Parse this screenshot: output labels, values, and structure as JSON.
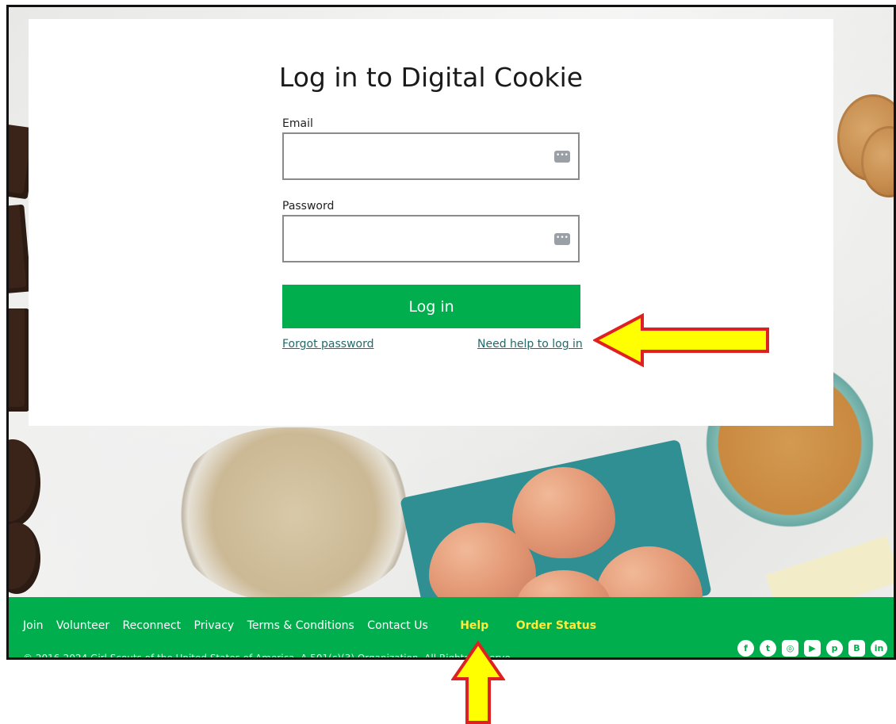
{
  "login": {
    "title": "Log in to Digital Cookie",
    "email_label": "Email",
    "email_value": "",
    "password_label": "Password",
    "password_value": "",
    "login_button": "Log in",
    "forgot_password": "Forgot password",
    "need_help": "Need help to log in"
  },
  "footer": {
    "nav": [
      {
        "label": "Join"
      },
      {
        "label": "Volunteer"
      },
      {
        "label": "Reconnect"
      },
      {
        "label": "Privacy"
      },
      {
        "label": "Terms & Conditions"
      },
      {
        "label": "Contact Us"
      }
    ],
    "help": "Help",
    "order_status": "Order Status",
    "copyright": "© 2016-2024 Girl Scouts of the United States of America. A 501(c)(3) Organization. All Rights Reserve",
    "social": [
      "facebook-icon",
      "twitter-icon",
      "instagram-icon",
      "youtube-icon",
      "pinterest-icon",
      "blog-icon",
      "linkedin-icon"
    ]
  },
  "colors": {
    "brand_green": "#00ae4d",
    "link_teal": "#236969",
    "highlight_yellow": "#ffeb3b",
    "annotation_arrow_fill": "#ffff00",
    "annotation_arrow_stroke": "#e02020"
  }
}
